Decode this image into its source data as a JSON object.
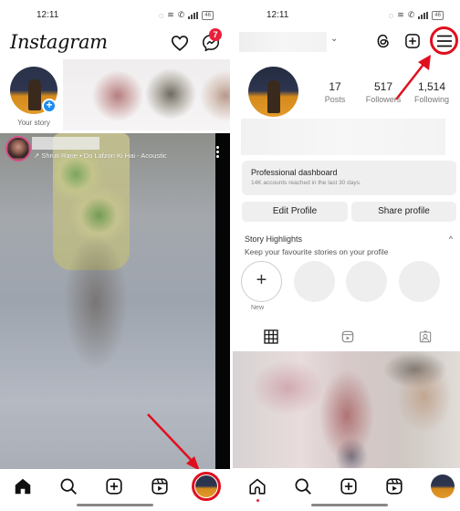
{
  "status_bar": {
    "time": "12:11",
    "battery": "46"
  },
  "feed_screen": {
    "header": {
      "logo": "Instagram",
      "icons": [
        "heart-icon",
        "messenger-icon"
      ],
      "messages_badge": "7"
    },
    "stories": {
      "own_story_label": "Your story"
    },
    "reel": {
      "audio_label": "Shruti Rane • Do Lafzon Ki Hai - Acoustic"
    },
    "nav": {
      "items": [
        "home",
        "search",
        "create",
        "reels",
        "profile"
      ],
      "highlighted": "profile"
    }
  },
  "profile_screen": {
    "header": {
      "icons": [
        "threads-icon",
        "create-icon",
        "menu-icon"
      ],
      "highlighted": "menu"
    },
    "stats": [
      {
        "value": "17",
        "label": "Posts"
      },
      {
        "value": "517",
        "label": "Followers"
      },
      {
        "value": "1,514",
        "label": "Following"
      }
    ],
    "dashboard": {
      "title": "Professional dashboard",
      "subtitle": "14K accounts reached in the last 30 days."
    },
    "buttons": {
      "edit": "Edit Profile",
      "share": "Share profile"
    },
    "highlights": {
      "title": "Story Highlights",
      "subtitle": "Keep your favourite stories on your profile",
      "new_label": "New",
      "new_symbol": "+",
      "caret": "^"
    },
    "tabs": [
      "grid",
      "reels",
      "tagged"
    ],
    "nav": {
      "items": [
        "home",
        "search",
        "create",
        "reels",
        "profile"
      ]
    }
  },
  "annotation_color": "#e00f1e"
}
